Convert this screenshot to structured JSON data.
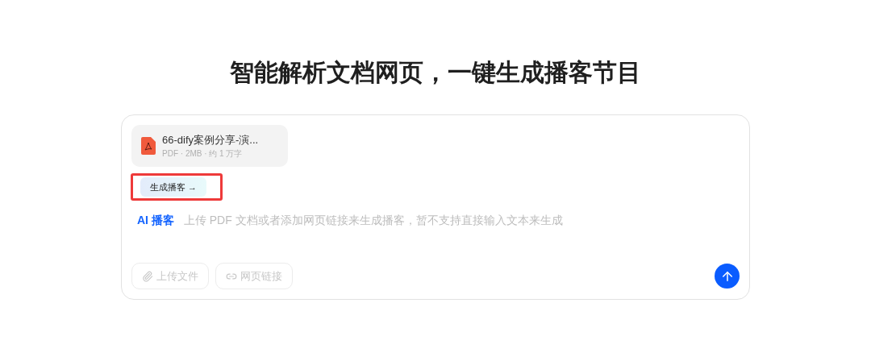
{
  "heading": "智能解析文档网页，一键生成播客节目",
  "file": {
    "name": "66-dify案例分享-演...",
    "meta": "PDF · 2MB · 约 1 万字"
  },
  "generate_button": {
    "label": "生成播客",
    "arrow": "→",
    "highlighted": true
  },
  "prompt": {
    "tag": "AI 播客",
    "placeholder": "上传 PDF 文档或者添加网页链接来生成播客，暂不支持直接输入文本来生成"
  },
  "tools": [
    {
      "kind": "upload",
      "label": "上传文件",
      "disabled": true
    },
    {
      "kind": "link",
      "label": "网页链接",
      "disabled": true
    }
  ],
  "send_button": {
    "disabled": false
  }
}
